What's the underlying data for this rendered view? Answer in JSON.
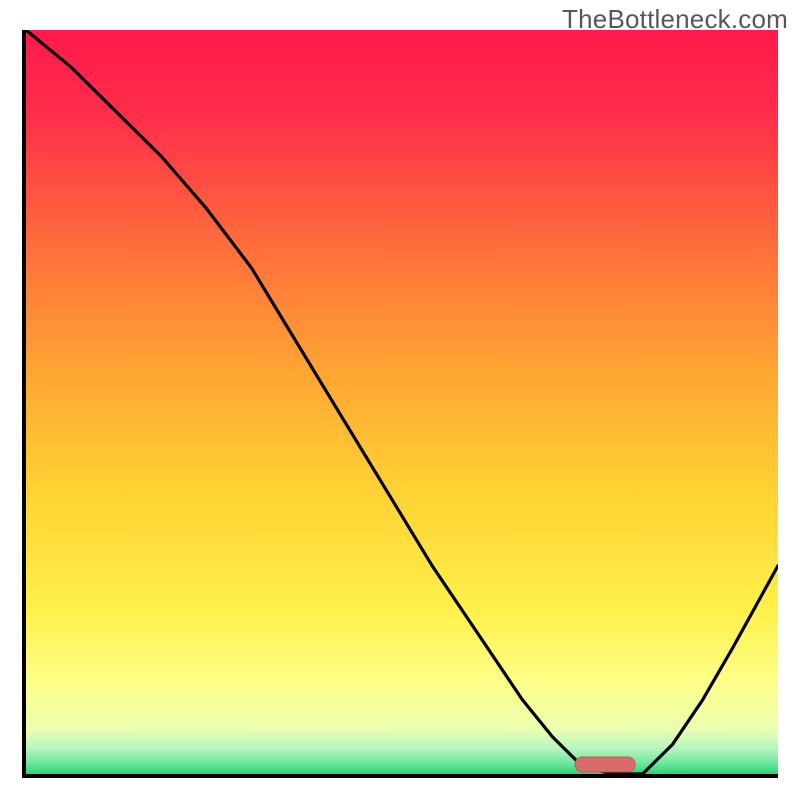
{
  "watermark": "TheBottleneck.com",
  "colors": {
    "axis": "#000000",
    "curve": "#000000",
    "marker_fill": "#d96b6b",
    "marker_stroke": "#c65555",
    "gradient_stops": [
      {
        "offset": 0.0,
        "color": "#ff1a4d"
      },
      {
        "offset": 0.12,
        "color": "#ff2f4a"
      },
      {
        "offset": 0.28,
        "color": "#ff6a3c"
      },
      {
        "offset": 0.45,
        "color": "#ffa233"
      },
      {
        "offset": 0.62,
        "color": "#ffd233"
      },
      {
        "offset": 0.78,
        "color": "#fff04a"
      },
      {
        "offset": 0.88,
        "color": "#fdff8a"
      },
      {
        "offset": 0.94,
        "color": "#eaffb0"
      },
      {
        "offset": 0.965,
        "color": "#b8f7c0"
      },
      {
        "offset": 0.985,
        "color": "#6fe8a0"
      },
      {
        "offset": 1.0,
        "color": "#28d37a"
      }
    ]
  },
  "chart_data": {
    "type": "line",
    "title": "",
    "xlabel": "",
    "ylabel": "",
    "xlim": [
      0,
      100
    ],
    "ylim": [
      0,
      100
    ],
    "legend": null,
    "grid": false,
    "annotations": [],
    "series": [
      {
        "name": "bottleneck-curve",
        "x": [
          0,
          6,
          12,
          18,
          24,
          30,
          36,
          42,
          48,
          54,
          60,
          66,
          70,
          74,
          78,
          82,
          86,
          90,
          94,
          100
        ],
        "y": [
          100,
          95,
          89,
          83,
          76,
          68,
          58,
          48,
          38,
          28,
          19,
          10,
          5,
          1,
          0,
          0,
          4,
          10,
          17,
          28
        ]
      }
    ],
    "marker": {
      "name": "optimal-range",
      "x_center": 77,
      "width": 8,
      "y": 0.7
    }
  }
}
